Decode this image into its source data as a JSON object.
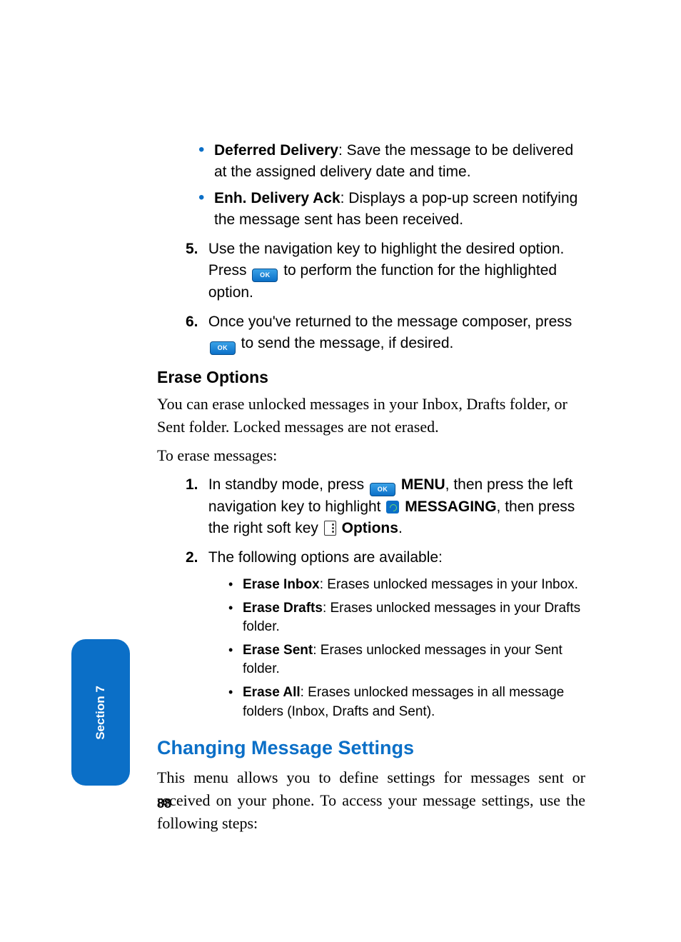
{
  "top_bullets": [
    {
      "term": "Deferred Delivery",
      "desc": ": Save the message to be delivered at the assigned delivery date and time."
    },
    {
      "term": "Enh. Delivery Ack",
      "desc": ": Displays a pop-up screen notifying the message sent has been received."
    }
  ],
  "step5": {
    "num": "5.",
    "pre": "Use the navigation key to highlight the desired option. Press ",
    "post": " to perform the function for the highlighted option."
  },
  "step6": {
    "num": "6.",
    "pre": "Once you've returned to the message composer, press ",
    "post": " to send the message, if desired."
  },
  "erase_heading": "Erase Options",
  "erase_para1": "You can erase unlocked messages in your Inbox, Drafts folder, or Sent folder. Locked messages are not erased.",
  "erase_para2": "To erase messages:",
  "erase_step1": {
    "num": "1.",
    "t1": "In standby mode, press ",
    "menu": "MENU",
    "t2": ", then press the left navigation key to highlight ",
    "messaging": "MESSAGING",
    "t3": ", then press the right soft key ",
    "options": "Options",
    "t4": "."
  },
  "erase_step2": {
    "num": "2.",
    "text": "The following options are available:"
  },
  "sub_bullets": [
    {
      "term": "Erase Inbox",
      "desc": ": Erases unlocked messages in your Inbox."
    },
    {
      "term": "Erase Drafts",
      "desc": ": Erases unlocked messages in your Drafts folder."
    },
    {
      "term": "Erase Sent",
      "desc": ": Erases unlocked messages in your Sent folder."
    },
    {
      "term": "Erase All",
      "desc": ":  Erases unlocked messages in all message folders (Inbox, Drafts and Sent)."
    }
  ],
  "changing_heading": "Changing Message Settings",
  "changing_para": "This menu allows you to define settings for messages sent or received on your phone. To access your message settings, use the following steps:",
  "page_number": "88",
  "section_label": "Section 7",
  "ok_label": "OK"
}
